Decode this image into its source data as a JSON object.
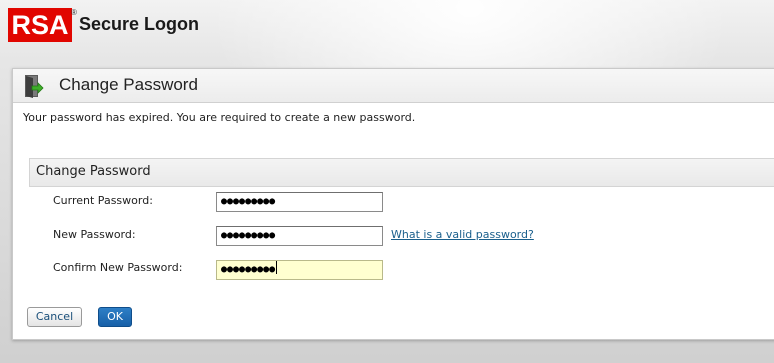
{
  "header": {
    "logo_text": "RSA",
    "logo_registered": "®",
    "app_title": "Secure Logon",
    "brand_color": "#e10600"
  },
  "panel": {
    "title": "Change Password",
    "icon": "door-exit-icon",
    "message": "Your password has expired. You are required to create a new password."
  },
  "section": {
    "title": "Change Password"
  },
  "fields": {
    "current_password": {
      "label": "Current Password:",
      "value": "●●●●●●●●●"
    },
    "new_password": {
      "label": "New Password:",
      "value": "●●●●●●●●●"
    },
    "confirm_password": {
      "label": "Confirm New Password:",
      "value": "●●●●●●●●●"
    }
  },
  "help_link": "What is a valid password?",
  "buttons": {
    "cancel": "Cancel",
    "ok": "OK",
    "ok_color": "#1760a8"
  }
}
